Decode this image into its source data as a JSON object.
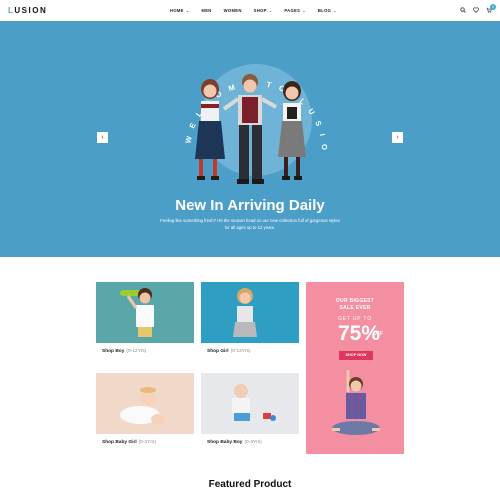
{
  "logo": {
    "first": "L",
    "rest": "USION"
  },
  "nav": {
    "items": [
      {
        "label": "HOME",
        "has_dropdown": true
      },
      {
        "label": "MEN",
        "has_dropdown": false
      },
      {
        "label": "WOMEN",
        "has_dropdown": false
      },
      {
        "label": "SHOP",
        "has_dropdown": true
      },
      {
        "label": "PAGES",
        "has_dropdown": true
      },
      {
        "label": "BLOG",
        "has_dropdown": true
      }
    ],
    "chevron": "⌄"
  },
  "header_icons": [
    "search-icon",
    "heart-icon",
    "cart-icon"
  ],
  "cart_count": "0",
  "hero": {
    "arc_text": "WELCOME TO LUSION",
    "title": "New In Arriving Daily",
    "subtitle": "Feeling like something fresh? Hit the season head on our new collection full of gorgeous styles for all ages up to 12 years.",
    "prev_arrow": "‹",
    "next_arrow": "›",
    "bg_color": "#4b9ec8"
  },
  "categories": [
    {
      "name": "Shop Boy",
      "age": "(0-12Yrs)",
      "bg": "#5aa7a9"
    },
    {
      "name": "Shop Girl",
      "age": "(0-12Yrs)",
      "bg": "#2e9fc2"
    },
    {
      "name": "Shop Baby Girl",
      "age": "(0-2Yrs)",
      "bg": "#f1d8c9"
    },
    {
      "name": "Shop Baby Boy",
      "age": "(0-3Yrs)",
      "bg": "#e6e8ec"
    }
  ],
  "promo": {
    "line1": "OUR BIGGEST",
    "line2": "SALE EVER",
    "line3": "GET UP TO",
    "percent": "75%",
    "off": "OFF",
    "button": "SHOP NOW",
    "bg": "#f48fa2"
  },
  "featured": {
    "title": "Featured Product"
  }
}
